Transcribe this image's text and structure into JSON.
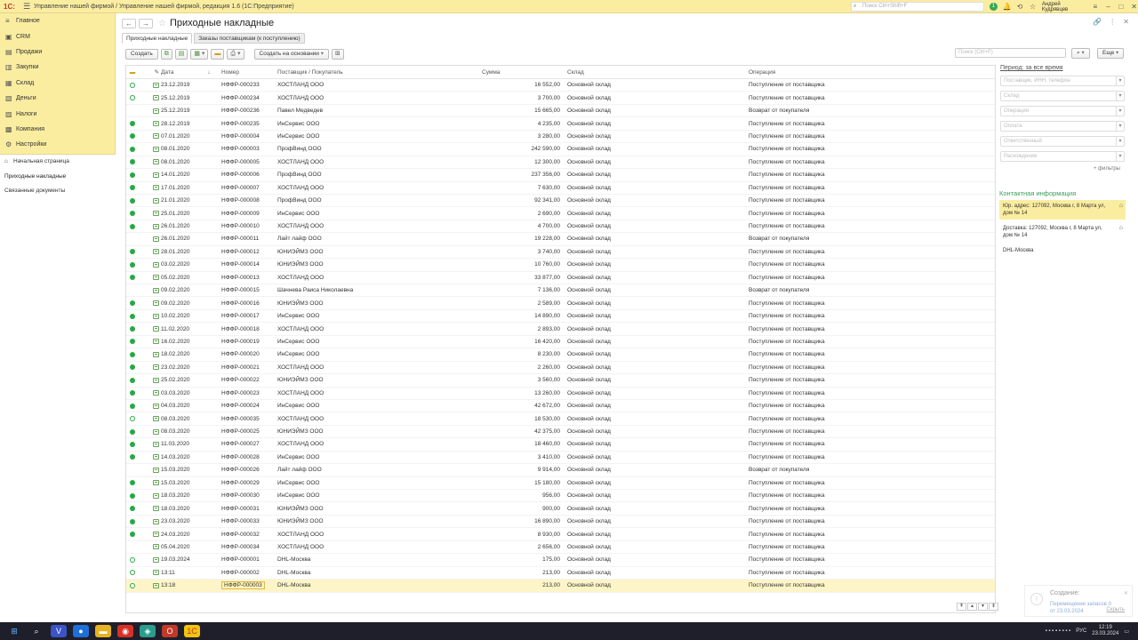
{
  "app": {
    "logo": "1С:",
    "title": "Управление нашей фирмой / Управление нашей фирмой, редакция 1.6  (1С:Предприятие)",
    "search_placeholder": "Поиск Ctrl+Shift+F",
    "notif_count": "1",
    "user": "Андрей Кудрявцев"
  },
  "sidebar": {
    "items": [
      {
        "label": "Главное",
        "icon": "≡"
      },
      {
        "label": "CRM",
        "icon": "▣"
      },
      {
        "label": "Продажи",
        "icon": "▤"
      },
      {
        "label": "Закупки",
        "icon": "▥"
      },
      {
        "label": "Склад",
        "icon": "▦"
      },
      {
        "label": "Деньги",
        "icon": "▧"
      },
      {
        "label": "Налоги",
        "icon": "▨"
      },
      {
        "label": "Компания",
        "icon": "▩"
      },
      {
        "label": "Настройки",
        "icon": "⚙"
      }
    ],
    "subnav": [
      {
        "label": "Начальная страница",
        "icon": "⌂"
      },
      {
        "label": "Приходные накладные",
        "icon": ""
      },
      {
        "label": "Связанные документы",
        "icon": ""
      }
    ]
  },
  "page": {
    "title": "Приходные накладные",
    "tabs": [
      "Приходные накладные",
      "Заказы поставщикам (к поступлению)"
    ]
  },
  "toolbar": {
    "create": "Создать",
    "create_based": "Создать на основании",
    "search_placeholder": "Поиск (Ctrl+F)",
    "more": "Еще"
  },
  "table": {
    "headers": {
      "date": "Дата",
      "number": "Номер",
      "supplier": "Поставщик / Покупатель",
      "sum": "Сумма",
      "warehouse": "Склад",
      "operation": "Операция"
    },
    "rows": [
      {
        "status": "unposted",
        "date": "23.12.2019",
        "number": "НФФР-000233",
        "supplier": "ХОСТЛАНД ООО",
        "sum": "16 552,00",
        "warehouse": "Основной склад",
        "operation": "Поступление от поставщика"
      },
      {
        "status": "unposted",
        "date": "25.12.2019",
        "number": "НФФР-000234",
        "supplier": "ХОСТЛАНД ООО",
        "sum": "3 700,00",
        "warehouse": "Основной склад",
        "operation": "Поступление от поставщика"
      },
      {
        "status": "none",
        "date": "25.12.2019",
        "number": "НФФР-000236",
        "supplier": "Павел Медведев",
        "sum": "15 665,00",
        "warehouse": "Основной склад",
        "operation": "Возврат от покупателя"
      },
      {
        "status": "posted",
        "date": "28.12.2019",
        "number": "НФФР-000235",
        "supplier": "ИнСервис ООО",
        "sum": "4 235,00",
        "warehouse": "Основной склад",
        "operation": "Поступление от поставщика"
      },
      {
        "status": "posted",
        "date": "07.01.2020",
        "number": "НФФР-000004",
        "supplier": "ИнСервис ООО",
        "sum": "3 280,00",
        "warehouse": "Основной склад",
        "operation": "Поступление от поставщика"
      },
      {
        "status": "posted",
        "date": "08.01.2020",
        "number": "НФФР-000003",
        "supplier": "ПрофВинд ООО",
        "sum": "242 590,00",
        "warehouse": "Основной склад",
        "operation": "Поступление от поставщика"
      },
      {
        "status": "posted",
        "date": "08.01.2020",
        "number": "НФФР-000005",
        "supplier": "ХОСТЛАНД ООО",
        "sum": "12 300,00",
        "warehouse": "Основной склад",
        "operation": "Поступление от поставщика"
      },
      {
        "status": "posted",
        "date": "14.01.2020",
        "number": "НФФР-000006",
        "supplier": "ПрофВинд ООО",
        "sum": "237 356,00",
        "warehouse": "Основной склад",
        "operation": "Поступление от поставщика"
      },
      {
        "status": "posted",
        "date": "17.01.2020",
        "number": "НФФР-000007",
        "supplier": "ХОСТЛАНД ООО",
        "sum": "7 630,00",
        "warehouse": "Основной склад",
        "operation": "Поступление от поставщика"
      },
      {
        "status": "posted",
        "date": "21.01.2020",
        "number": "НФФР-000008",
        "supplier": "ПрофВинд ООО",
        "sum": "92 341,00",
        "warehouse": "Основной склад",
        "operation": "Поступление от поставщика"
      },
      {
        "status": "posted",
        "date": "25.01.2020",
        "number": "НФФР-000009",
        "supplier": "ИнСервис ООО",
        "sum": "2 690,00",
        "warehouse": "Основной склад",
        "operation": "Поступление от поставщика"
      },
      {
        "status": "posted",
        "date": "26.01.2020",
        "number": "НФФР-000010",
        "supplier": "ХОСТЛАНД ООО",
        "sum": "4 700,00",
        "warehouse": "Основной склад",
        "operation": "Поступление от поставщика"
      },
      {
        "status": "none",
        "date": "26.01.2020",
        "number": "НФФР-000011",
        "supplier": "Лайт лайф ООО",
        "sum": "19 228,00",
        "warehouse": "Основной склад",
        "operation": "Возврат от покупателя"
      },
      {
        "status": "posted",
        "date": "28.01.2020",
        "number": "НФФР-000012",
        "supplier": "ЮНИЭЙМЗ ООО",
        "sum": "3 740,00",
        "warehouse": "Основной склад",
        "operation": "Поступление от поставщика"
      },
      {
        "status": "posted",
        "date": "03.02.2020",
        "number": "НФФР-000014",
        "supplier": "ЮНИЭЙМЗ ООО",
        "sum": "10 760,00",
        "warehouse": "Основной склад",
        "operation": "Поступление от поставщика"
      },
      {
        "status": "posted",
        "date": "05.02.2020",
        "number": "НФФР-000013",
        "supplier": "ХОСТЛАНД ООО",
        "sum": "33 877,00",
        "warehouse": "Основной склад",
        "operation": "Поступление от поставщика"
      },
      {
        "status": "none",
        "date": "09.02.2020",
        "number": "НФФР-000015",
        "supplier": "Шачнева Раиса Николаевна",
        "sum": "7 136,00",
        "warehouse": "Основной склад",
        "operation": "Возврат от покупателя"
      },
      {
        "status": "posted",
        "date": "09.02.2020",
        "number": "НФФР-000016",
        "supplier": "ЮНИЭЙМЗ ООО",
        "sum": "2 589,00",
        "warehouse": "Основной склад",
        "operation": "Поступление от поставщика"
      },
      {
        "status": "posted",
        "date": "10.02.2020",
        "number": "НФФР-000017",
        "supplier": "ИнСервис ООО",
        "sum": "14 890,00",
        "warehouse": "Основной склад",
        "operation": "Поступление от поставщика"
      },
      {
        "status": "posted",
        "date": "11.02.2020",
        "number": "НФФР-000018",
        "supplier": "ХОСТЛАНД ООО",
        "sum": "2 893,00",
        "warehouse": "Основной склад",
        "operation": "Поступление от поставщика"
      },
      {
        "status": "posted",
        "date": "16.02.2020",
        "number": "НФФР-000019",
        "supplier": "ИнСервис ООО",
        "sum": "16 420,00",
        "warehouse": "Основной склад",
        "operation": "Поступление от поставщика"
      },
      {
        "status": "posted",
        "date": "18.02.2020",
        "number": "НФФР-000020",
        "supplier": "ИнСервис ООО",
        "sum": "8 230,00",
        "warehouse": "Основной склад",
        "operation": "Поступление от поставщика"
      },
      {
        "status": "posted",
        "date": "23.02.2020",
        "number": "НФФР-000021",
        "supplier": "ХОСТЛАНД ООО",
        "sum": "2 260,00",
        "warehouse": "Основной склад",
        "operation": "Поступление от поставщика"
      },
      {
        "status": "posted",
        "date": "25.02.2020",
        "number": "НФФР-000022",
        "supplier": "ЮНИЭЙМЗ ООО",
        "sum": "3 560,00",
        "warehouse": "Основной склад",
        "operation": "Поступление от поставщика"
      },
      {
        "status": "posted",
        "date": "03.03.2020",
        "number": "НФФР-000023",
        "supplier": "ХОСТЛАНД ООО",
        "sum": "13 260,00",
        "warehouse": "Основной склад",
        "operation": "Поступление от поставщика"
      },
      {
        "status": "posted",
        "date": "04.03.2020",
        "number": "НФФР-000024",
        "supplier": "ИнСервис ООО",
        "sum": "42 672,00",
        "warehouse": "Основной склад",
        "operation": "Поступление от поставщика"
      },
      {
        "status": "unposted",
        "date": "08.03.2020",
        "number": "НФФР-000035",
        "supplier": "ХОСТЛАНД ООО",
        "sum": "18 530,00",
        "warehouse": "Основной склад",
        "operation": "Поступление от поставщика"
      },
      {
        "status": "posted",
        "date": "08.03.2020",
        "number": "НФФР-000025",
        "supplier": "ЮНИЭЙМЗ ООО",
        "sum": "42 375,00",
        "warehouse": "Основной склад",
        "operation": "Поступление от поставщика"
      },
      {
        "status": "posted",
        "date": "11.03.2020",
        "number": "НФФР-000027",
        "supplier": "ХОСТЛАНД ООО",
        "sum": "18 460,00",
        "warehouse": "Основной склад",
        "operation": "Поступление от поставщика"
      },
      {
        "status": "posted",
        "date": "14.03.2020",
        "number": "НФФР-000028",
        "supplier": "ИнСервис ООО",
        "sum": "3 410,00",
        "warehouse": "Основной склад",
        "operation": "Поступление от поставщика"
      },
      {
        "status": "none",
        "date": "15.03.2020",
        "number": "НФФР-000026",
        "supplier": "Лайт лайф ООО",
        "sum": "9 914,00",
        "warehouse": "Основной склад",
        "operation": "Возврат от покупателя"
      },
      {
        "status": "posted",
        "date": "15.03.2020",
        "number": "НФФР-000029",
        "supplier": "ИнСервис ООО",
        "sum": "15 180,00",
        "warehouse": "Основной склад",
        "operation": "Поступление от поставщика"
      },
      {
        "status": "posted",
        "date": "18.03.2020",
        "number": "НФФР-000030",
        "supplier": "ИнСервис ООО",
        "sum": "956,00",
        "warehouse": "Основной склад",
        "operation": "Поступление от поставщика"
      },
      {
        "status": "posted",
        "date": "18.03.2020",
        "number": "НФФР-000031",
        "supplier": "ЮНИЭЙМЗ ООО",
        "sum": "900,00",
        "warehouse": "Основной склад",
        "operation": "Поступление от поставщика"
      },
      {
        "status": "posted",
        "date": "23.03.2020",
        "number": "НФФР-000033",
        "supplier": "ЮНИЭЙМЗ ООО",
        "sum": "16 890,00",
        "warehouse": "Основной склад",
        "operation": "Поступление от поставщика"
      },
      {
        "status": "posted",
        "date": "24.03.2020",
        "number": "НФФР-000032",
        "supplier": "ХОСТЛАНД ООО",
        "sum": "8 930,00",
        "warehouse": "Основной склад",
        "operation": "Поступление от поставщика"
      },
      {
        "status": "none",
        "date": "05.04.2020",
        "number": "НФФР-000034",
        "supplier": "ХОСТЛАНД ООО",
        "sum": "2 656,00",
        "warehouse": "Основной склад",
        "operation": "Поступление от поставщика"
      },
      {
        "status": "unposted",
        "date": "19.03.2024",
        "number": "НФФР-000001",
        "supplier": "DHL-Москва",
        "sum": "175,00",
        "warehouse": "Основной склад",
        "operation": "Поступление от поставщика"
      },
      {
        "status": "unposted",
        "date": "13:11",
        "number": "НФФР-000002",
        "supplier": "DHL-Москва",
        "sum": "213,00",
        "warehouse": "Основной склад",
        "operation": "Поступление от поставщика"
      },
      {
        "status": "unposted",
        "date": "13:18",
        "number": "НФФР-000003",
        "supplier": "DHL-Москва",
        "sum": "213,00",
        "warehouse": "Основной склад",
        "operation": "Поступление от поставщика",
        "selected": true
      }
    ]
  },
  "panel": {
    "period": "Период: за все время",
    "filters": [
      "Поставщик, ИНН, телефон",
      "Склад",
      "Операция",
      "Оплата",
      "Ответственный",
      "Расхождения"
    ],
    "more_filters": "+ фильтры",
    "contact_title": "Контактная информация",
    "contacts": [
      {
        "text": "Юр. адрес: 127092, Москва г, 8 Марта ул, дом № 14",
        "highlight": true
      },
      {
        "text": "Доставка: 127092, Москва г, 8 Марта ул, дом № 14",
        "highlight": false
      },
      {
        "text": "DHL-Москва",
        "highlight": false
      }
    ]
  },
  "notification": {
    "title": "Создание:",
    "text1": "Перемещение запасов 0",
    "text2": "от 23.03.2024",
    "hide": "Скрыть"
  },
  "taskbar": {
    "lang": "РУС",
    "time": "12:19",
    "date": "23.03.2024"
  },
  "colors": {
    "accent_yellow": "#fbeda0",
    "posted_green": "#27a844",
    "contact_green": "#3d9a5b"
  }
}
